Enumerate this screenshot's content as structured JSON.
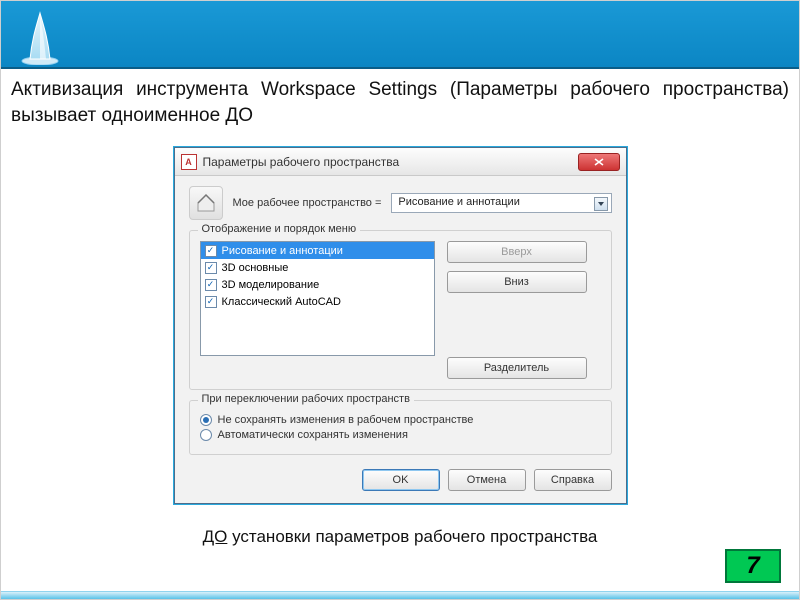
{
  "heading": "Активизация инструмента Workspace Settings (Параметры рабочего пространства) вызывает одноименное ДО",
  "dialog": {
    "title": "Параметры рабочего пространства",
    "label_myws": "Мое рабочее пространство =",
    "combo_value": "Рисование и аннотации",
    "group_menu_title": "Отображение и порядок меню",
    "list": [
      {
        "label": "Рисование и аннотации",
        "checked": true,
        "selected": true
      },
      {
        "label": "3D основные",
        "checked": true,
        "selected": false
      },
      {
        "label": "3D моделирование",
        "checked": true,
        "selected": false
      },
      {
        "label": "Классический AutoCAD",
        "checked": true,
        "selected": false
      }
    ],
    "btn_up": "Вверх",
    "btn_down": "Вниз",
    "btn_sep": "Разделитель",
    "group_switch_title": "При переключении рабочих пространств",
    "radio_nosave": "Не сохранять изменения в рабочем пространстве",
    "radio_autosave": "Автоматически сохранять изменения",
    "radio_selected": 0,
    "ok": "OK",
    "cancel": "Отмена",
    "help": "Справка"
  },
  "caption_underlined": "ДО",
  "caption_rest": " установки параметров рабочего пространства",
  "page_number": "7"
}
